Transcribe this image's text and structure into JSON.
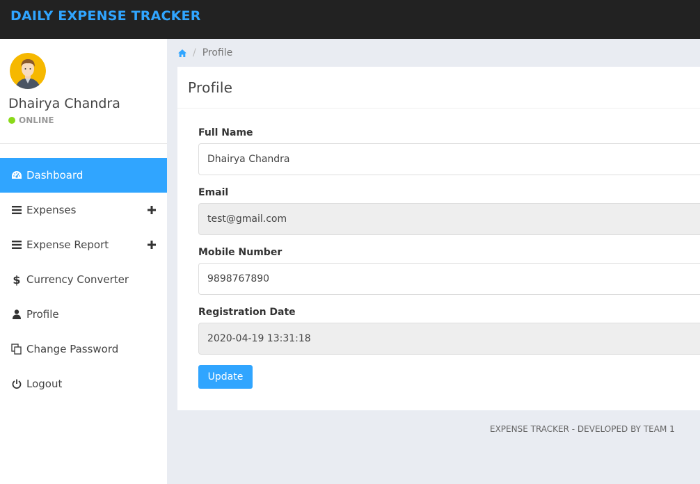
{
  "app": {
    "brand": "DAILY EXPENSE TRACKER"
  },
  "user": {
    "name": "Dhairya Chandra",
    "status": "ONLINE"
  },
  "sidebar": {
    "items": [
      {
        "label": "Dashboard",
        "icon": "dashboard-icon",
        "active": true
      },
      {
        "label": "Expenses",
        "icon": "list-icon",
        "expandable": true
      },
      {
        "label": "Expense Report",
        "icon": "list-icon",
        "expandable": true
      },
      {
        "label": "Currency Converter",
        "icon": "dollar-icon"
      },
      {
        "label": "Profile",
        "icon": "user-icon"
      },
      {
        "label": "Change Password",
        "icon": "copy-icon"
      },
      {
        "label": "Logout",
        "icon": "power-icon"
      }
    ]
  },
  "breadcrumb": {
    "home_icon": "home-icon",
    "current": "Profile"
  },
  "profile": {
    "heading": "Profile",
    "full_name": {
      "label": "Full Name",
      "value": "Dhairya Chandra"
    },
    "email": {
      "label": "Email",
      "value": "test@gmail.com"
    },
    "mobile": {
      "label": "Mobile Number",
      "value": "9898767890"
    },
    "registration": {
      "label": "Registration Date",
      "value": "2020-04-19 13:31:18"
    },
    "update_label": "Update"
  },
  "footer": {
    "text": "EXPENSE TRACKER - DEVELOPED BY TEAM 1"
  },
  "colors": {
    "accent": "#30a5ff",
    "navbar": "#222222",
    "online": "#8ad919"
  }
}
